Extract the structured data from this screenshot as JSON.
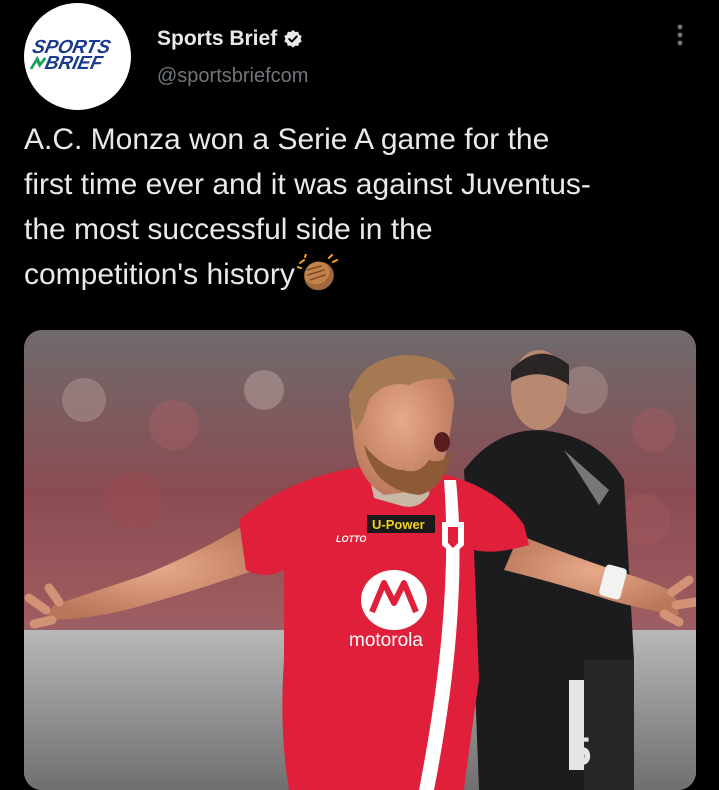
{
  "author": {
    "display_name": "Sports Brief",
    "handle": "@sportsbriefcom",
    "avatar_text_line1": "SPORTS",
    "avatar_text_line2": "BRIEF",
    "verified": true
  },
  "tweet": {
    "text": "A.C. Monza won a Serie A game for the\nfirst time ever and it was against Juventus-\nthe most successful side in the\ncompetition's history",
    "emoji": "clapping-hands-medium-dark-skin"
  },
  "media": {
    "shirt_sponsor": "motorola",
    "shirt_brand": "LOTTO",
    "sleeve_sponsor": "U-Power",
    "opponent_number": "5"
  },
  "colors": {
    "background": "#000000",
    "text": "#e7e9ea",
    "secondary_text": "#71767b",
    "brand_blue": "#1a3a8f",
    "brand_green": "#19a35f",
    "monza_red": "#e0203a"
  }
}
